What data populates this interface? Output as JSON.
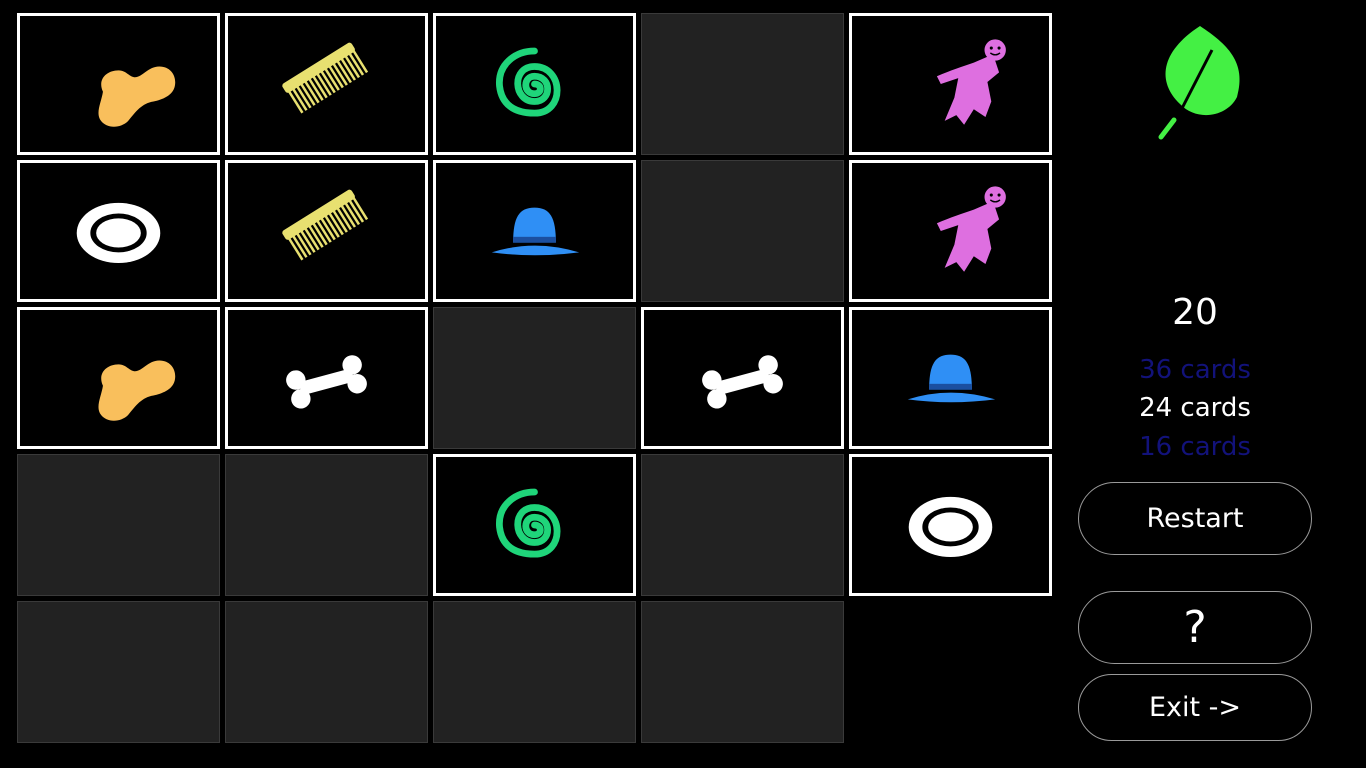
{
  "game": {
    "score": "20",
    "size_options": [
      {
        "label": "36 cards",
        "selected": false
      },
      {
        "label": "24 cards",
        "selected": true
      },
      {
        "label": "16 cards",
        "selected": false
      }
    ],
    "buttons": {
      "restart": "Restart",
      "help": "?",
      "exit": "Exit ->"
    },
    "current_icon": "leaf-icon",
    "colors": {
      "peanut": "#f9bf5c",
      "comb": "#e8e070",
      "spiral": "#1fd57a",
      "doll": "#de6fe0",
      "hat": "#2f8ff5",
      "leaf": "#44f044",
      "card_back": "#222222",
      "dim_option": "#12127a"
    }
  },
  "board": {
    "rows": [
      [
        "peanut",
        "comb",
        "spiral",
        "hidden",
        "doll"
      ],
      [
        "plate",
        "comb",
        "hat",
        "hidden",
        "doll"
      ],
      [
        "peanut",
        "bone",
        "hidden",
        "bone",
        "hat"
      ],
      [
        "hidden",
        "hidden",
        "spiral",
        "hidden",
        "plate"
      ],
      [
        "hidden",
        "hidden",
        "hidden",
        "hidden",
        "empty"
      ]
    ]
  }
}
